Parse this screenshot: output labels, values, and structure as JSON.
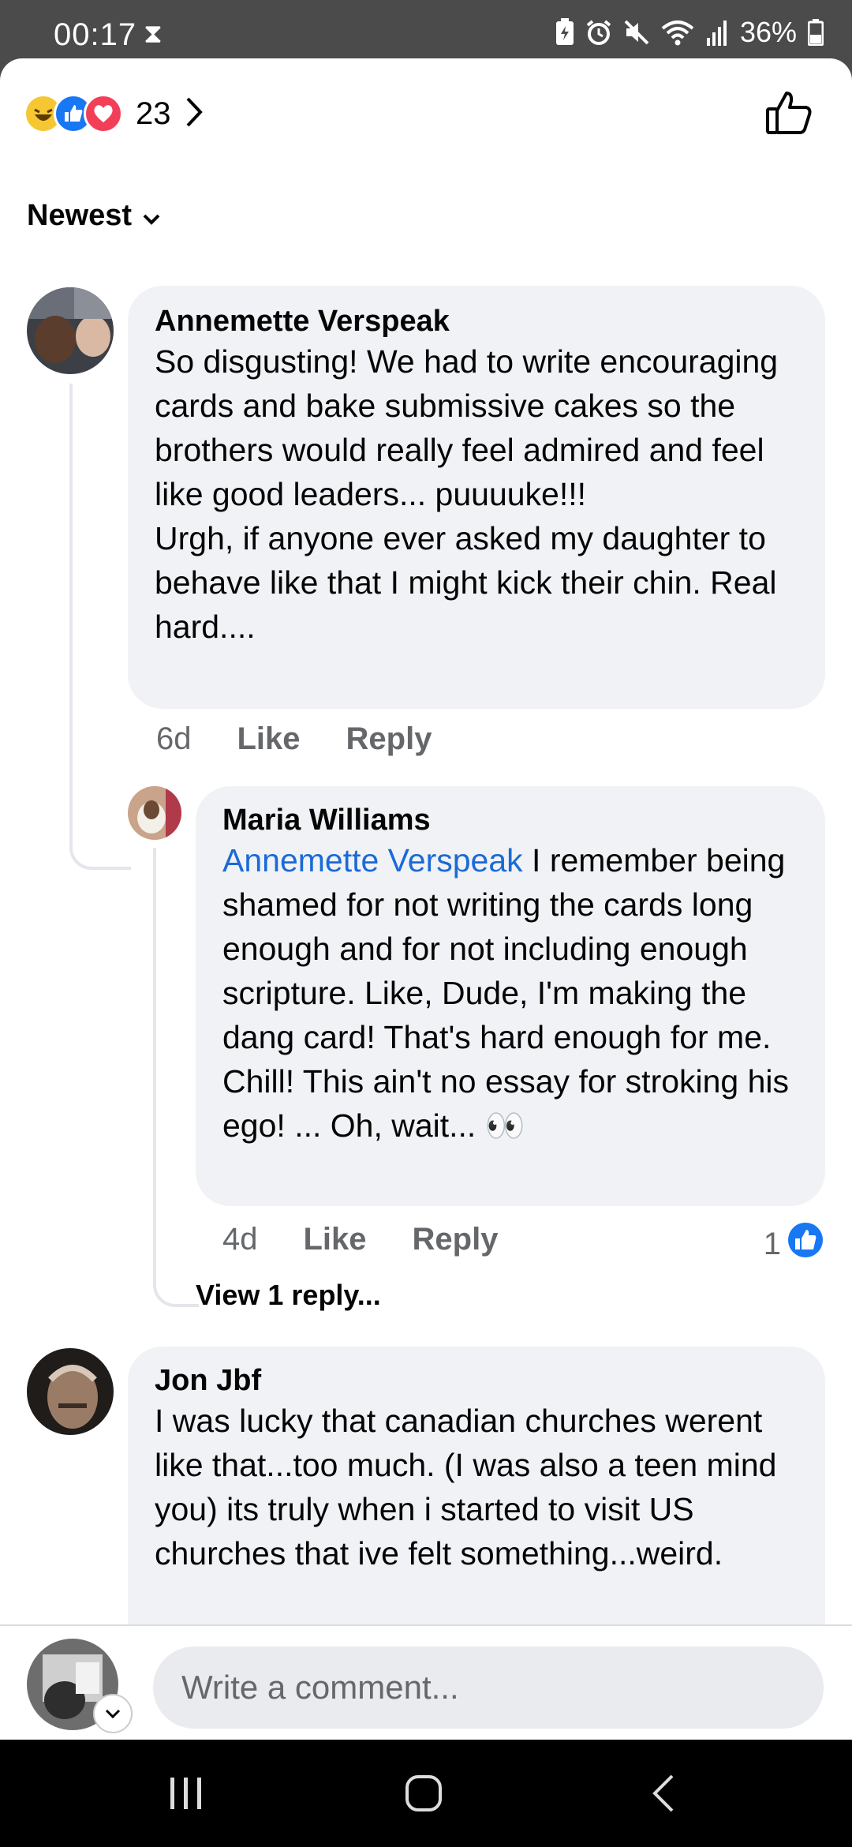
{
  "status_bar": {
    "time": "00:17",
    "battery": "36%"
  },
  "reactions": {
    "count": "23",
    "types": [
      "haha",
      "like",
      "love"
    ]
  },
  "sort": {
    "label": "Newest"
  },
  "comments": [
    {
      "author": "Annemette Verspeak",
      "text": "So disgusting! We had to write encouraging cards and bake submissive cakes so the brothers would really feel admired and feel like good leaders... puuuuke!!!\nUrgh, if anyone ever asked my daughter to behave like that I might kick their chin. Real hard....",
      "age": "6d",
      "like_label": "Like",
      "reply_label": "Reply"
    },
    {
      "author": "Maria Williams",
      "mention": "Annemette Verspeak",
      "text": " I remember being shamed for not writing the cards long enough and for not including enough scripture. Like, Dude, I'm making the dang card! That's hard enough for me. Chill! This ain't no essay for stroking his ego! ... Oh, wait... 👀",
      "age": "4d",
      "like_label": "Like",
      "reply_label": "Reply",
      "like_count": "1"
    },
    {
      "author": "Jon Jbf",
      "text": "I was lucky that canadian churches werent like that...too much. (I was also a teen mind you) its truly when i started to visit US churches that ive felt something...weird."
    }
  ],
  "view_replies": "View 1 reply...",
  "composer": {
    "placeholder": "Write a comment..."
  },
  "colors": {
    "link": "#1b6ad6",
    "bubble": "#f0f2f5",
    "like_blue": "#1877f2",
    "meta_gray": "#65676b"
  }
}
